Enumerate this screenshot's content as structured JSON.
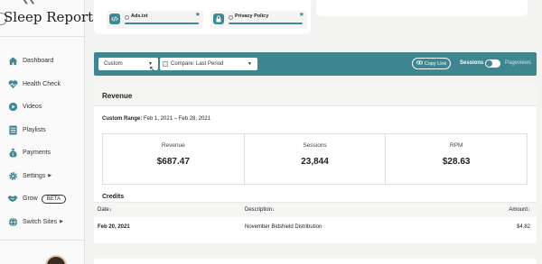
{
  "brand": {
    "name": "Sleep Report"
  },
  "nav": [
    {
      "label": "Dashboard",
      "icon": "home-icon",
      "caret": false
    },
    {
      "label": "Health Check",
      "icon": "heart-pulse-icon",
      "caret": false
    },
    {
      "label": "Videos",
      "icon": "play-icon",
      "caret": false
    },
    {
      "label": "Playlists",
      "icon": "list-icon",
      "caret": false
    },
    {
      "label": "Payments",
      "icon": "money-bag-icon",
      "caret": false
    },
    {
      "label": "Settings",
      "icon": "gear-icon",
      "caret": true
    },
    {
      "label": "Grow",
      "icon": "handshake-icon",
      "badge": "BETA",
      "caret": false
    },
    {
      "label": "Switch Sites",
      "icon": "globe-icon",
      "caret": true
    }
  ],
  "files": [
    {
      "name": "Ads.txt",
      "icon": "code-icon"
    },
    {
      "name": "Privacy Policy",
      "icon": "lock-icon"
    }
  ],
  "filters": {
    "range_select": "Custom",
    "compare_select": "Compare: Last Period",
    "copy_link": "Copy Link",
    "toggle_left": "Sessions",
    "toggle_right": "Pageviews"
  },
  "revenue": {
    "title": "Revenue",
    "range_label": "Custom Range:",
    "range_value": "Feb 1, 2021 – Feb 28, 2021",
    "stats": [
      {
        "label": "Revenue",
        "value": "$687.47"
      },
      {
        "label": "Sessions",
        "value": "23,844"
      },
      {
        "label": "RPM",
        "value": "$28.63"
      }
    ],
    "credits_title": "Credits",
    "table": {
      "headers": {
        "date": "Date↓",
        "description": "Description↓",
        "amount": "Amount↓"
      },
      "rows": [
        {
          "date": "Feb 20, 2021",
          "description": "November Bidshield Distribution",
          "amount": "$4.82"
        }
      ]
    }
  },
  "colors": {
    "accent": "#3e8791",
    "sidebar_bg": "#fafafa",
    "page_bg": "#f3f3f1"
  }
}
